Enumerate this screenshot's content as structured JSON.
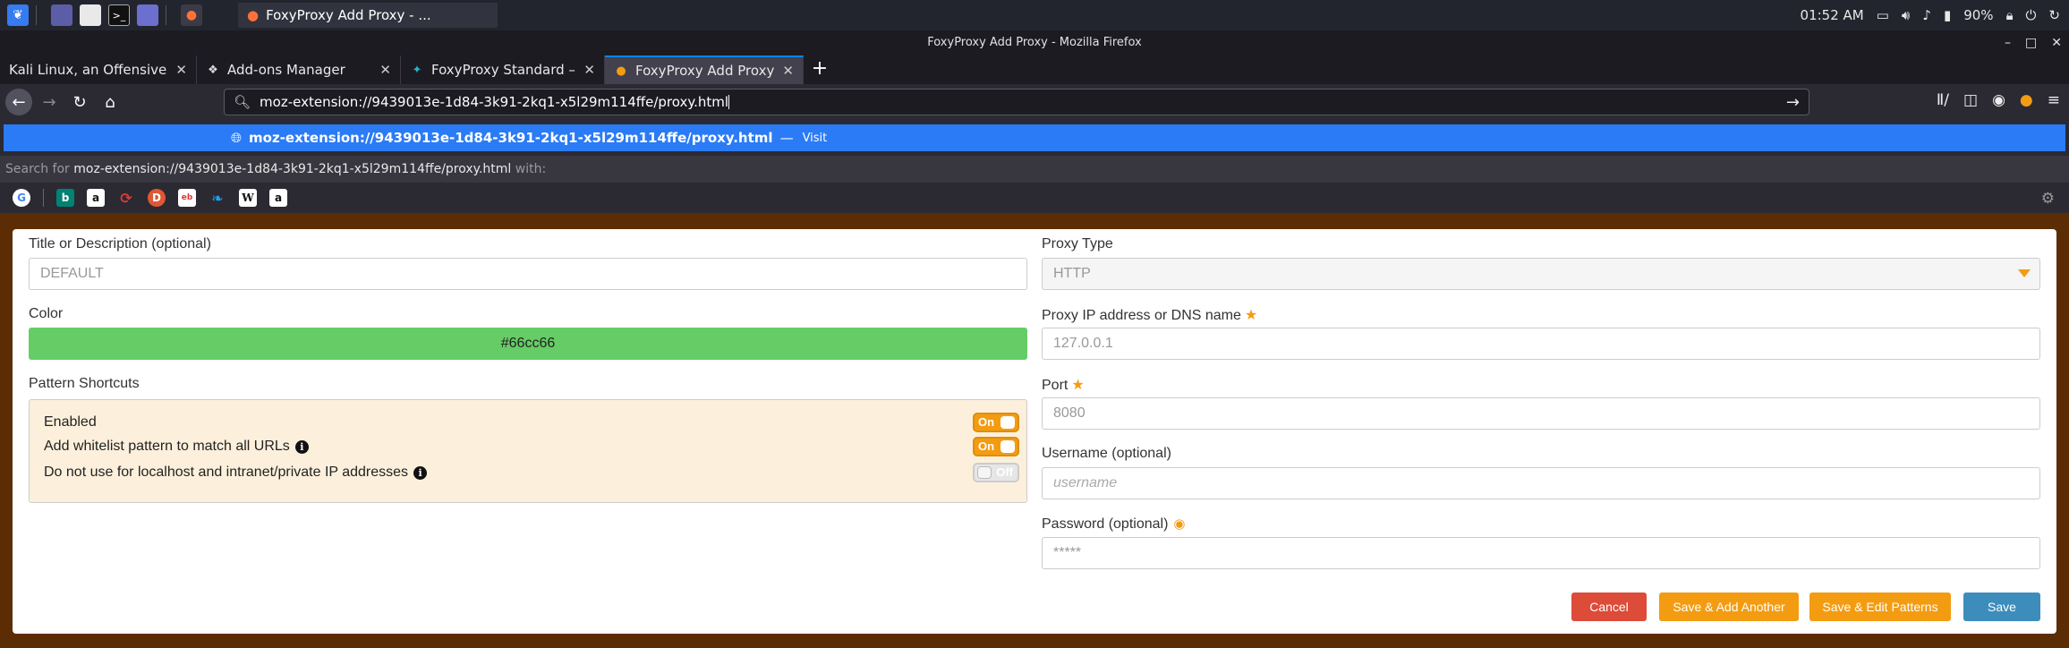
{
  "taskbar": {
    "time": "01:52 AM",
    "battery": "90%",
    "active_task": "FoxyProxy Add Proxy - ..."
  },
  "window": {
    "title": "FoxyProxy Add Proxy - Mozilla Firefox"
  },
  "tabs": [
    {
      "label": "Kali Linux, an Offensive Secu",
      "icon": "kali-dragon-icon"
    },
    {
      "label": "Add-ons Manager",
      "icon": "puzzle-icon"
    },
    {
      "label": "FoxyProxy Standard – Get",
      "icon": "foxyproxy-icon"
    },
    {
      "label": "FoxyProxy Add Proxy",
      "icon": "foxyproxy-icon"
    }
  ],
  "urlbar": {
    "value": "moz-extension://9439013e-1d84-3k91-2kq1-x5l29m114ffe/proxy.html"
  },
  "suggestion": {
    "url": "moz-extension://9439013e-1d84-3k91-2kq1-x5l29m114ffe/proxy.html",
    "dash": "—",
    "action": "Visit"
  },
  "searchfor": {
    "prefix": "Search for",
    "query": "moz-extension://9439013e-1d84-3k91-2kq1-x5l29m114ffe/proxy.html",
    "suffix": "with:"
  },
  "form": {
    "title_label": "Title or Description (optional)",
    "title_placeholder": "DEFAULT",
    "color_label": "Color",
    "color_value": "#66cc66",
    "shortcuts_label": "Pattern Shortcuts",
    "shortcuts": [
      {
        "label": "Enabled",
        "state": "On",
        "info": false
      },
      {
        "label": "Add whitelist pattern to match all URLs",
        "state": "On",
        "info": true
      },
      {
        "label": "Do not use for localhost and intranet/private IP addresses",
        "state": "Off",
        "info": true
      }
    ],
    "proxy_type_label": "Proxy Type",
    "proxy_type_value": "HTTP",
    "ip_label": "Proxy IP address or DNS name",
    "ip_placeholder": "127.0.0.1",
    "port_label": "Port",
    "port_placeholder": "8080",
    "username_label": "Username (optional)",
    "username_placeholder": "username",
    "password_label": "Password (optional)",
    "password_placeholder": "*****"
  },
  "buttons": {
    "cancel": "Cancel",
    "save_add_another": "Save & Add Another",
    "save_edit_patterns": "Save & Edit Patterns",
    "save": "Save"
  },
  "colors": {
    "page_bg": "#5c2d05",
    "accent_orange": "#f39c12",
    "cancel_red": "#dd4b39",
    "save_blue": "#3c8dbc",
    "proxy_color": "#66cc66"
  }
}
